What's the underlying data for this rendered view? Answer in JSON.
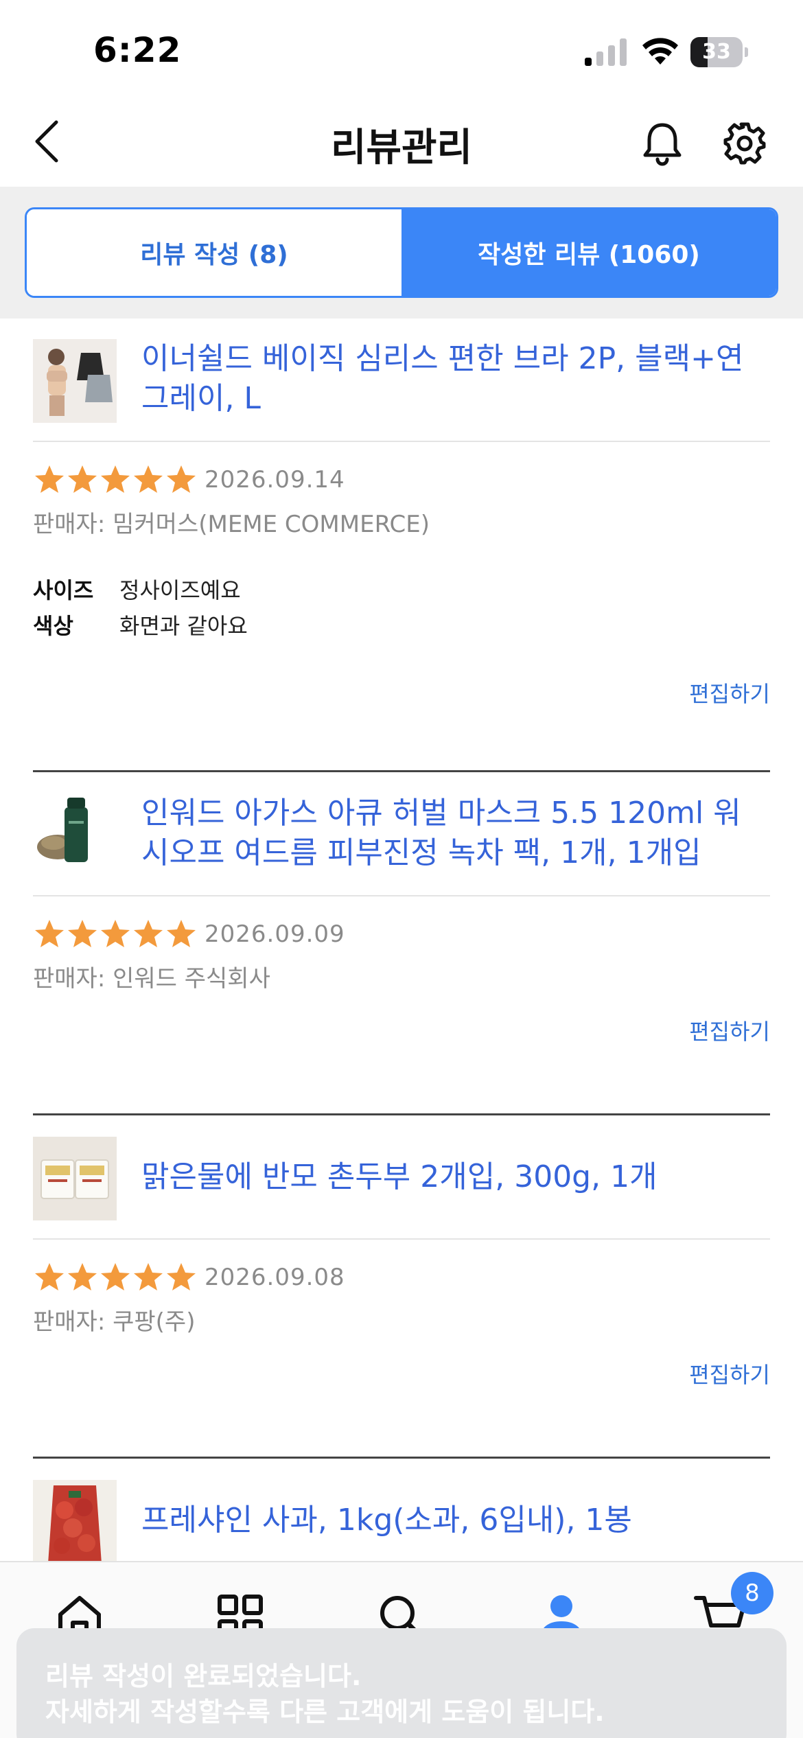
{
  "status_bar": {
    "time": "6:22",
    "battery": "33",
    "battery_level": 0.33
  },
  "header": {
    "title": "리뷰관리"
  },
  "tabs": [
    {
      "label": "리뷰 작성 (8)",
      "active": false
    },
    {
      "label": "작성한 리뷰 (1060)",
      "active": true
    }
  ],
  "reviews": [
    {
      "product_name": "이너쉴드 베이직 심리스 편한 브라 2P, 블랙+연그레이, L",
      "rating": 5,
      "date": "2026.09.14",
      "seller": "판매자: 밈커머스(MEME COMMERCE)",
      "attributes": [
        {
          "key": "사이즈",
          "value": "정사이즈예요"
        },
        {
          "key": "색상",
          "value": "화면과 같아요"
        }
      ],
      "edit_label": "편집하기"
    },
    {
      "product_name": "인워드 아가스 아큐 허벌 마스크 5.5 120ml 워시오프 여드름 피부진정 녹차 팩, 1개, 1개입",
      "rating": 5,
      "date": "2026.09.09",
      "seller": "판매자: 인워드 주식회사",
      "edit_label": "편집하기"
    },
    {
      "product_name": "맑은물에 반모 촌두부 2개입, 300g, 1개",
      "rating": 5,
      "date": "2026.09.08",
      "seller": "판매자: 쿠팡(주)",
      "edit_label": "편집하기"
    },
    {
      "product_name": "프레샤인 사과, 1kg(소과, 6입내), 1봉"
    }
  ],
  "bottom_nav": {
    "items": [
      "home-icon",
      "category-grid-icon",
      "search-icon",
      "my-page-icon",
      "cart-icon"
    ],
    "cart_badge": "8",
    "active_color": "#3b86f7"
  },
  "toast": {
    "line1": "리뷰 작성이 완료되었습니다.",
    "line2": "자세하게 작성할수록 다른 고객에게 도움이 됩니다."
  },
  "colors": {
    "accent": "#3b86f7",
    "link": "#3563d9",
    "star": "#f39a3c"
  }
}
